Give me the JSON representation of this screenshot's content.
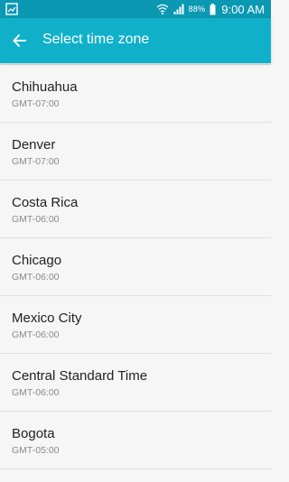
{
  "colors": {
    "status_bar": "#0a98b3",
    "app_bar": "#10b0cb",
    "background": "#f6f6f6",
    "item_text": "#222222",
    "item_subtext": "#8a8a8a"
  },
  "status_bar": {
    "left_icon": "gallery-icon",
    "wifi_icon": "wifi-icon",
    "signal_icon": "signal-icon",
    "battery_percent": "88%",
    "battery_icon": "battery-icon",
    "time": "9:00 AM"
  },
  "app_bar": {
    "back_icon": "arrow-back-icon",
    "title": "Select time zone"
  },
  "time_zones": [
    {
      "name": "Chihuahua",
      "offset": "GMT-07:00"
    },
    {
      "name": "Denver",
      "offset": "GMT-07:00"
    },
    {
      "name": "Costa Rica",
      "offset": "GMT-06:00"
    },
    {
      "name": "Chicago",
      "offset": "GMT-06:00"
    },
    {
      "name": "Mexico City",
      "offset": "GMT-06:00"
    },
    {
      "name": "Central Standard Time",
      "offset": "GMT-06:00"
    },
    {
      "name": "Bogota",
      "offset": "GMT-05:00"
    }
  ]
}
